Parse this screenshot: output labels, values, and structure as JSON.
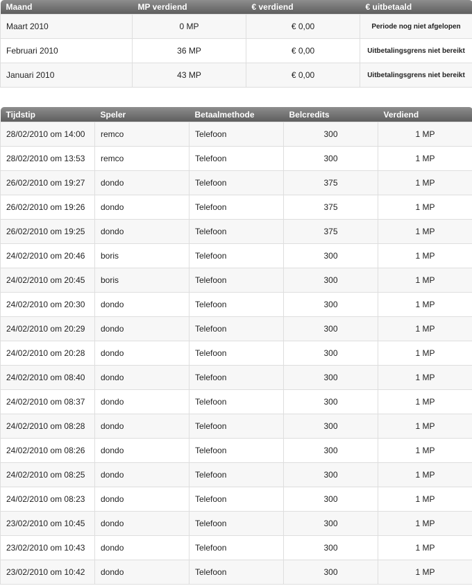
{
  "summary": {
    "headers": [
      "Maand",
      "MP verdiend",
      "€ verdiend",
      "€ uitbetaald"
    ],
    "rows": [
      {
        "month": "Maart 2010",
        "mp": "0 MP",
        "euro": "€ 0,00",
        "paid": "Periode nog niet afgelopen"
      },
      {
        "month": "Februari 2010",
        "mp": "36 MP",
        "euro": "€ 0,00",
        "paid": "Uitbetalingsgrens niet bereikt"
      },
      {
        "month": "Januari 2010",
        "mp": "43 MP",
        "euro": "€ 0,00",
        "paid": "Uitbetalingsgrens niet bereikt"
      }
    ]
  },
  "transactions": {
    "headers": [
      "Tijdstip",
      "Speler",
      "Betaalmethode",
      "Belcredits",
      "Verdiend"
    ],
    "rows": [
      {
        "time": "28/02/2010 om 14:00",
        "player": "remco",
        "method": "Telefoon",
        "credits": "300",
        "earned": "1 MP"
      },
      {
        "time": "28/02/2010 om 13:53",
        "player": "remco",
        "method": "Telefoon",
        "credits": "300",
        "earned": "1 MP"
      },
      {
        "time": "26/02/2010 om 19:27",
        "player": "dondo",
        "method": "Telefoon",
        "credits": "375",
        "earned": "1 MP"
      },
      {
        "time": "26/02/2010 om 19:26",
        "player": "dondo",
        "method": "Telefoon",
        "credits": "375",
        "earned": "1 MP"
      },
      {
        "time": "26/02/2010 om 19:25",
        "player": "dondo",
        "method": "Telefoon",
        "credits": "375",
        "earned": "1 MP"
      },
      {
        "time": "24/02/2010 om 20:46",
        "player": "boris",
        "method": "Telefoon",
        "credits": "300",
        "earned": "1 MP"
      },
      {
        "time": "24/02/2010 om 20:45",
        "player": "boris",
        "method": "Telefoon",
        "credits": "300",
        "earned": "1 MP"
      },
      {
        "time": "24/02/2010 om 20:30",
        "player": "dondo",
        "method": "Telefoon",
        "credits": "300",
        "earned": "1 MP"
      },
      {
        "time": "24/02/2010 om 20:29",
        "player": "dondo",
        "method": "Telefoon",
        "credits": "300",
        "earned": "1 MP"
      },
      {
        "time": "24/02/2010 om 20:28",
        "player": "dondo",
        "method": "Telefoon",
        "credits": "300",
        "earned": "1 MP"
      },
      {
        "time": "24/02/2010 om 08:40",
        "player": "dondo",
        "method": "Telefoon",
        "credits": "300",
        "earned": "1 MP"
      },
      {
        "time": "24/02/2010 om 08:37",
        "player": "dondo",
        "method": "Telefoon",
        "credits": "300",
        "earned": "1 MP"
      },
      {
        "time": "24/02/2010 om 08:28",
        "player": "dondo",
        "method": "Telefoon",
        "credits": "300",
        "earned": "1 MP"
      },
      {
        "time": "24/02/2010 om 08:26",
        "player": "dondo",
        "method": "Telefoon",
        "credits": "300",
        "earned": "1 MP"
      },
      {
        "time": "24/02/2010 om 08:25",
        "player": "dondo",
        "method": "Telefoon",
        "credits": "300",
        "earned": "1 MP"
      },
      {
        "time": "24/02/2010 om 08:23",
        "player": "dondo",
        "method": "Telefoon",
        "credits": "300",
        "earned": "1 MP"
      },
      {
        "time": "23/02/2010 om 10:45",
        "player": "dondo",
        "method": "Telefoon",
        "credits": "300",
        "earned": "1 MP"
      },
      {
        "time": "23/02/2010 om 10:43",
        "player": "dondo",
        "method": "Telefoon",
        "credits": "300",
        "earned": "1 MP"
      },
      {
        "time": "23/02/2010 om 10:42",
        "player": "dondo",
        "method": "Telefoon",
        "credits": "300",
        "earned": "1 MP"
      }
    ]
  }
}
